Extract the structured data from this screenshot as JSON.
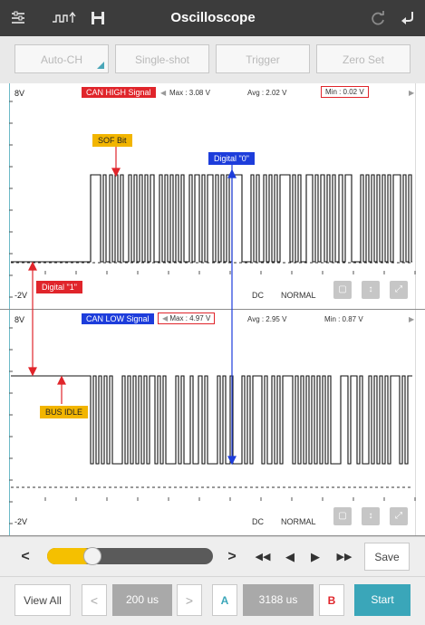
{
  "app": {
    "title": "Oscilloscope"
  },
  "toolbar": {
    "menu_icon": "menu-icon",
    "wave_icon": "waveform-icon",
    "save_icon": "save-icon",
    "refresh_icon": "refresh-icon",
    "back_icon": "back-icon"
  },
  "modes": {
    "autoch": "Auto-CH",
    "single": "Single-shot",
    "trigger": "Trigger",
    "zeroset": "Zero Set"
  },
  "ch1": {
    "ymax": "8V",
    "ymin": "-2V",
    "signal": "CAN HIGH Signal",
    "max": "Max : 3.08 V",
    "avg": "Avg : 2.02 V",
    "min": "Min : 0.02 V",
    "coupling": "DC",
    "mode": "NORMAL",
    "sof": "SOF Bit",
    "dig0": "Digital \"0\"",
    "dig1": "Digital \"1\""
  },
  "ch2": {
    "ymax": "8V",
    "ymin": "-2V",
    "signal": "CAN LOW Signal",
    "max": "Max : 4.97 V",
    "avg": "Avg : 2.95 V",
    "min": "Min : 0.87 V",
    "coupling": "DC",
    "mode": "NORMAL",
    "idle": "BUS IDLE"
  },
  "nav": {
    "slider_fraction": 0.23,
    "prev": "<",
    "next": ">",
    "rewind": "◀◀",
    "back": "◀",
    "play": "▶",
    "ff": "▶▶",
    "save": "Save"
  },
  "bottom": {
    "viewall": "View All",
    "dec": "<",
    "timebase": "200 us",
    "inc": ">",
    "a": "A",
    "delta": "3188 us",
    "b": "B",
    "start": "Start"
  },
  "colors": {
    "topbar": "#3c3c3c",
    "accent": "#3aa6b9",
    "red": "#e0252b",
    "blue": "#1d3ddb",
    "yellow": "#f2b500",
    "slider": "#f5c000"
  }
}
